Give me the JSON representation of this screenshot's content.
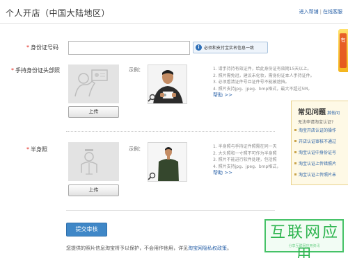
{
  "page": {
    "title": "个人开店（中国大陆地区）"
  },
  "header": {
    "links": [
      {
        "label": "进入帮铺"
      },
      {
        "label": "在线客服"
      }
    ],
    "separator": "|"
  },
  "id_field": {
    "label": "身份证号码",
    "value": "",
    "hint": "必须和支付宝实名信息一致"
  },
  "headshot_section": {
    "label": "手持身份证头部照",
    "example_label": "示例：",
    "upload_label": "上传",
    "rules": [
      "1. 请手持持有效证件，给此身份证有效期15天以上。",
      "2. 照片需免冠，建议未化妆，需身份证本人手持证件。",
      "3. 必须看清证件号且证件号不能被遮挡。",
      "4. 照片支持jpg、jpeg、bmp格式，最大不超过5M。"
    ],
    "help_label": "帮助 >>"
  },
  "halfbody_section": {
    "label": "半身照",
    "example_label": "示例：",
    "upload_label": "上传",
    "rules": [
      "1. 半身照与手持证件照需在同一天",
      "2. 大头照和一寸照不可作为半身照",
      "3. 照片不能进行软件处理，包括照",
      "4. 照片支持jpg、jpeg、bmp格式，"
    ],
    "help_label": "帮助 >>"
  },
  "submit": {
    "label": "提交审核"
  },
  "privacy": {
    "prefix": "您提供的照片信息淘宝将予以保护，不会用作他用，详见",
    "link": "淘宝网隐私权政策",
    "suffix": "。"
  },
  "faq": {
    "title": "常见问题",
    "subtitle": "其他问",
    "tip": "无法申请淘宝认证?",
    "items": [
      "淘宝开店认证的操作",
      "开店认证审核不通过",
      "淘宝认证中身份证号",
      "淘宝认证上传错照片",
      "淘宝认证上传照片未"
    ]
  },
  "side_tab": {
    "label": "有奖调查"
  },
  "watermark": {
    "text": "互联网应用",
    "sub": "分享互联网应用资讯"
  },
  "colors": {
    "accent": "#3f87c7",
    "link": "#2a62a8",
    "required": "#e2231a",
    "faq_bg": "#fef9e6",
    "watermark": "#2fb550"
  },
  "icons": {
    "info": "info-icon",
    "zoom": "magnifier-icon",
    "id_card_placeholder": "id-card-person-icon",
    "person_placeholder": "person-silhouette-icon"
  }
}
